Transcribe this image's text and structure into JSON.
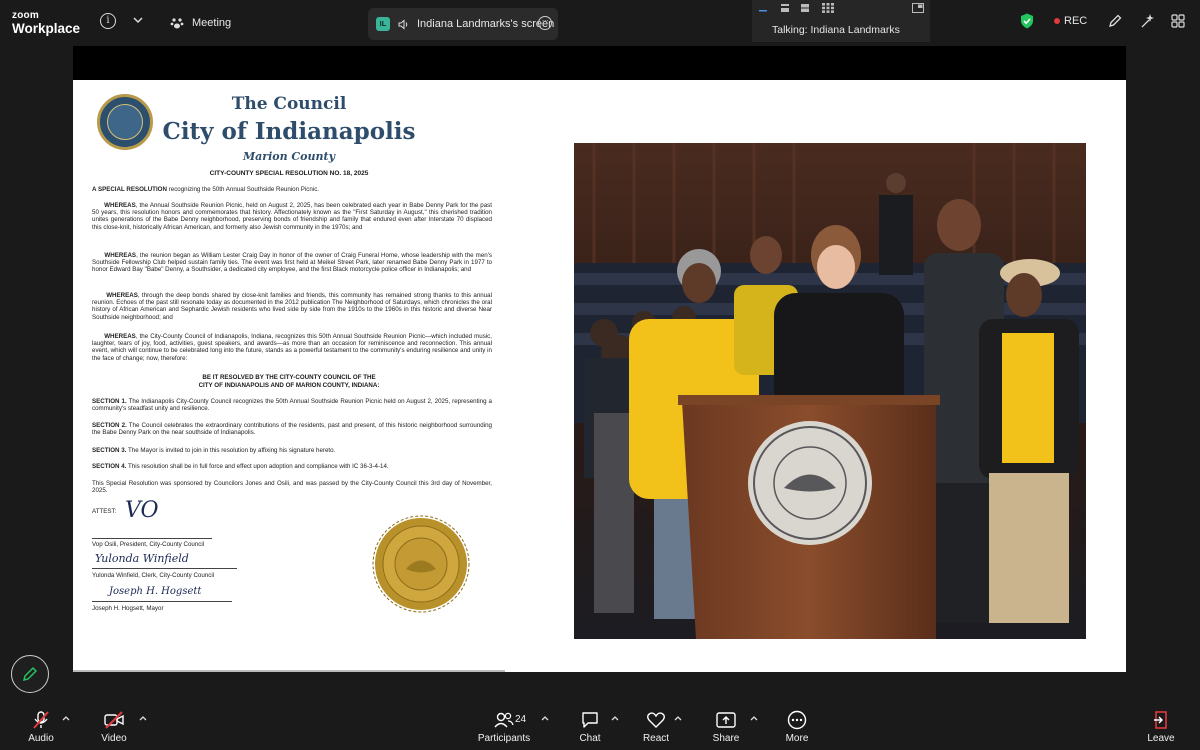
{
  "app": {
    "logo_line1": "zoom",
    "logo_line2": "Workplace"
  },
  "topbar": {
    "meeting_label": "Meeting",
    "share_badge": "IL",
    "share_label": "Indiana Landmarks's screen",
    "talking_label": "Talking: Indiana Landmarks",
    "rec_label": "REC",
    "rec_color": "#e0393e",
    "security_color": "#23c55e"
  },
  "document": {
    "header_line1": "The Council",
    "header_line2": "City of Indianapolis",
    "header_line3": "Marion County",
    "resolution_no": "CITY-COUNTY SPECIAL RESOLUTION NO. 18, 2025",
    "intro_prefix": "A SPECIAL RESOLUTION",
    "intro_text": "recognizing the 50th Annual Southside Reunion Picnic.",
    "whereas_label": "WHEREAS",
    "whereas1": ", the Annual Southside Reunion Picnic, held on August 2, 2025, has been celebrated each year in Babe Denny Park for the past 50 years, this resolution honors and commemorates that history. Affectionately known as the \"First Saturday in August,\" this cherished tradition unites generations of the Babe Denny neighborhood, preserving bonds of friendship and family that endured even after Interstate 70 displaced this close-knit, historically African American, and formerly also Jewish community in the 1970s; and",
    "whereas2": ", the reunion began as William Lester Craig Day in honor of the owner of Craig Funeral Home, whose leadership with the men's Southside Fellowship Club helped sustain family ties. The event was first held at Meikel Street Park, later renamed Babe Denny Park in 1977 to honor Edward Bay \"Babe\" Denny, a Southsider, a dedicated city employee, and the first Black motorcycle police officer in Indianapolis; and",
    "whereas3": ", through the deep bonds shared by close-knit families and friends, this community has remained strong thanks to this annual reunion. Echoes of the past still resonate today as documented in the 2012 publication The Neighborhood of Saturdays, which chronicles the oral history of African American and Sephardic Jewish residents who lived side by side from the 1910s to the 1960s in this historic and diverse Near Southside neighborhood; and",
    "whereas4": ", the City-County Council of Indianapolis, Indiana, recognizes this 50th Annual Southside Reunion Picnic—which included music, laughter, tears of joy, food, activities, guest speakers, and awards—as more than an occasion for reminiscence and reconnection. This annual event, which will continue to be celebrated long into the future, stands as a powerful testament to the community's enduring resilience and unity in the face of change; now, therefore:",
    "resolved_line1": "BE IT RESOLVED BY THE CITY-COUNTY COUNCIL OF THE",
    "resolved_line2": "CITY OF INDIANAPOLIS AND OF MARION COUNTY, INDIANA:",
    "section1_label": "SECTION 1.",
    "section1": "The Indianapolis City-County Council recognizes the 50th Annual Southside Reunion Picnic held on August 2, 2025, representing a community's steadfast unity and resilience.",
    "section2_label": "SECTION 2.",
    "section2": "The Council celebrates the extraordinary contributions of the residents, past and present, of this historic neighborhood surrounding the Babe Denny Park on the near southside of Indianapolis.",
    "section3_label": "SECTION 3.",
    "section3": "The Mayor is invited to join in this resolution by affixing his signature hereto.",
    "section4_label": "SECTION 4.",
    "section4": "This resolution shall be in full force and effect upon adoption and compliance with IC 36-3-4-14.",
    "sponsor_text": "This Special Resolution was sponsored by Councilors Jones and Osili, and was passed by the City-County Council this 3rd day of November, 2025.",
    "attest_label": "ATTEST:",
    "sig1_scrawl": "VO",
    "sig1_name": "Vop Osili, President, City-County Council",
    "sig2_scrawl": "Yulonda Winfield",
    "sig2_name": "Yulonda Winfield, Clerk, City-County Council",
    "sig3_scrawl": "Joseph H. Hogsett",
    "sig3_name": "Joseph H. Hogsett, Mayor"
  },
  "toolbar": {
    "audio_label": "Audio",
    "video_label": "Video",
    "participants_label": "Participants",
    "participants_count": "24",
    "chat_label": "Chat",
    "react_label": "React",
    "share_label": "Share",
    "more_label": "More",
    "leave_label": "Leave",
    "muted_color": "#e0393e"
  }
}
